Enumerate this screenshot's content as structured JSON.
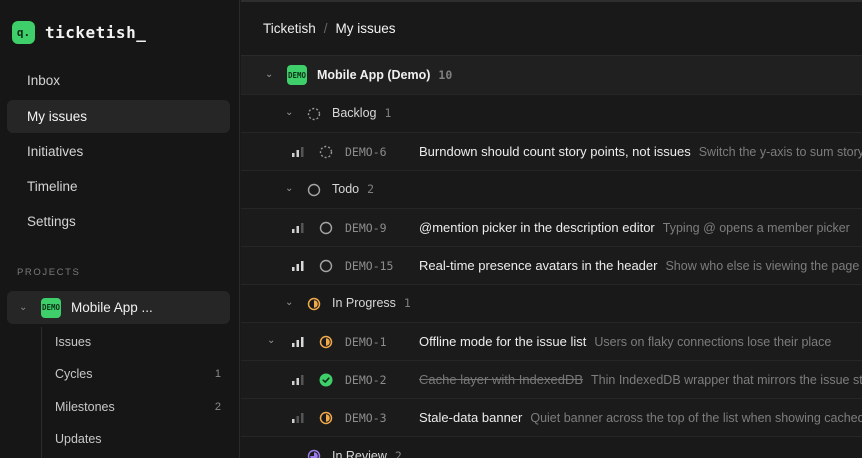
{
  "app": {
    "name": "ticketish_",
    "logo_glyph": "q."
  },
  "sidebar": {
    "nav": [
      {
        "label": "Inbox"
      },
      {
        "label": "My issues",
        "active": true
      },
      {
        "label": "Initiatives"
      },
      {
        "label": "Timeline"
      },
      {
        "label": "Settings"
      }
    ],
    "projects_label": "PROJECTS",
    "project": {
      "badge": "DEMO",
      "name": "Mobile App ...",
      "items": [
        {
          "label": "Issues",
          "count": ""
        },
        {
          "label": "Cycles",
          "count": "1"
        },
        {
          "label": "Milestones",
          "count": "2"
        },
        {
          "label": "Updates",
          "count": ""
        }
      ]
    }
  },
  "breadcrumb": {
    "root": "Ticketish",
    "separator": "/",
    "current": "My issues"
  },
  "project_group": {
    "badge": "DEMO",
    "name": "Mobile App (Demo)",
    "count": "10"
  },
  "groups": {
    "backlog": {
      "label": "Backlog",
      "count": "1"
    },
    "todo": {
      "label": "Todo",
      "count": "2"
    },
    "in_progress": {
      "label": "In Progress",
      "count": "1"
    },
    "in_review": {
      "label": "In Review",
      "count": "2"
    }
  },
  "issues": {
    "demo6": {
      "id": "DEMO-6",
      "title": "Burndown should count story points, not issues",
      "desc": "Switch the y-axis to sum story points"
    },
    "demo9": {
      "id": "DEMO-9",
      "title": "@mention picker in the description editor",
      "desc": "Typing @ opens a member picker"
    },
    "demo15": {
      "id": "DEMO-15",
      "title": "Real-time presence avatars in the header",
      "desc": "Show who else is viewing the page"
    },
    "demo1": {
      "id": "DEMO-1",
      "title": "Offline mode for the issue list",
      "desc": "Users on flaky connections lose their place"
    },
    "demo2": {
      "id": "DEMO-2",
      "title": "Cache layer with IndexedDB",
      "desc": "Thin IndexedDB wrapper that mirrors the issue store"
    },
    "demo3": {
      "id": "DEMO-3",
      "title": "Stale-data banner",
      "desc": "Quiet banner across the top of the list when showing cached data"
    }
  },
  "colors": {
    "accent": "#3ecf6a",
    "in_progress": "#f0a94b",
    "done": "#3ecf6a",
    "in_review": "#9b7bea"
  }
}
